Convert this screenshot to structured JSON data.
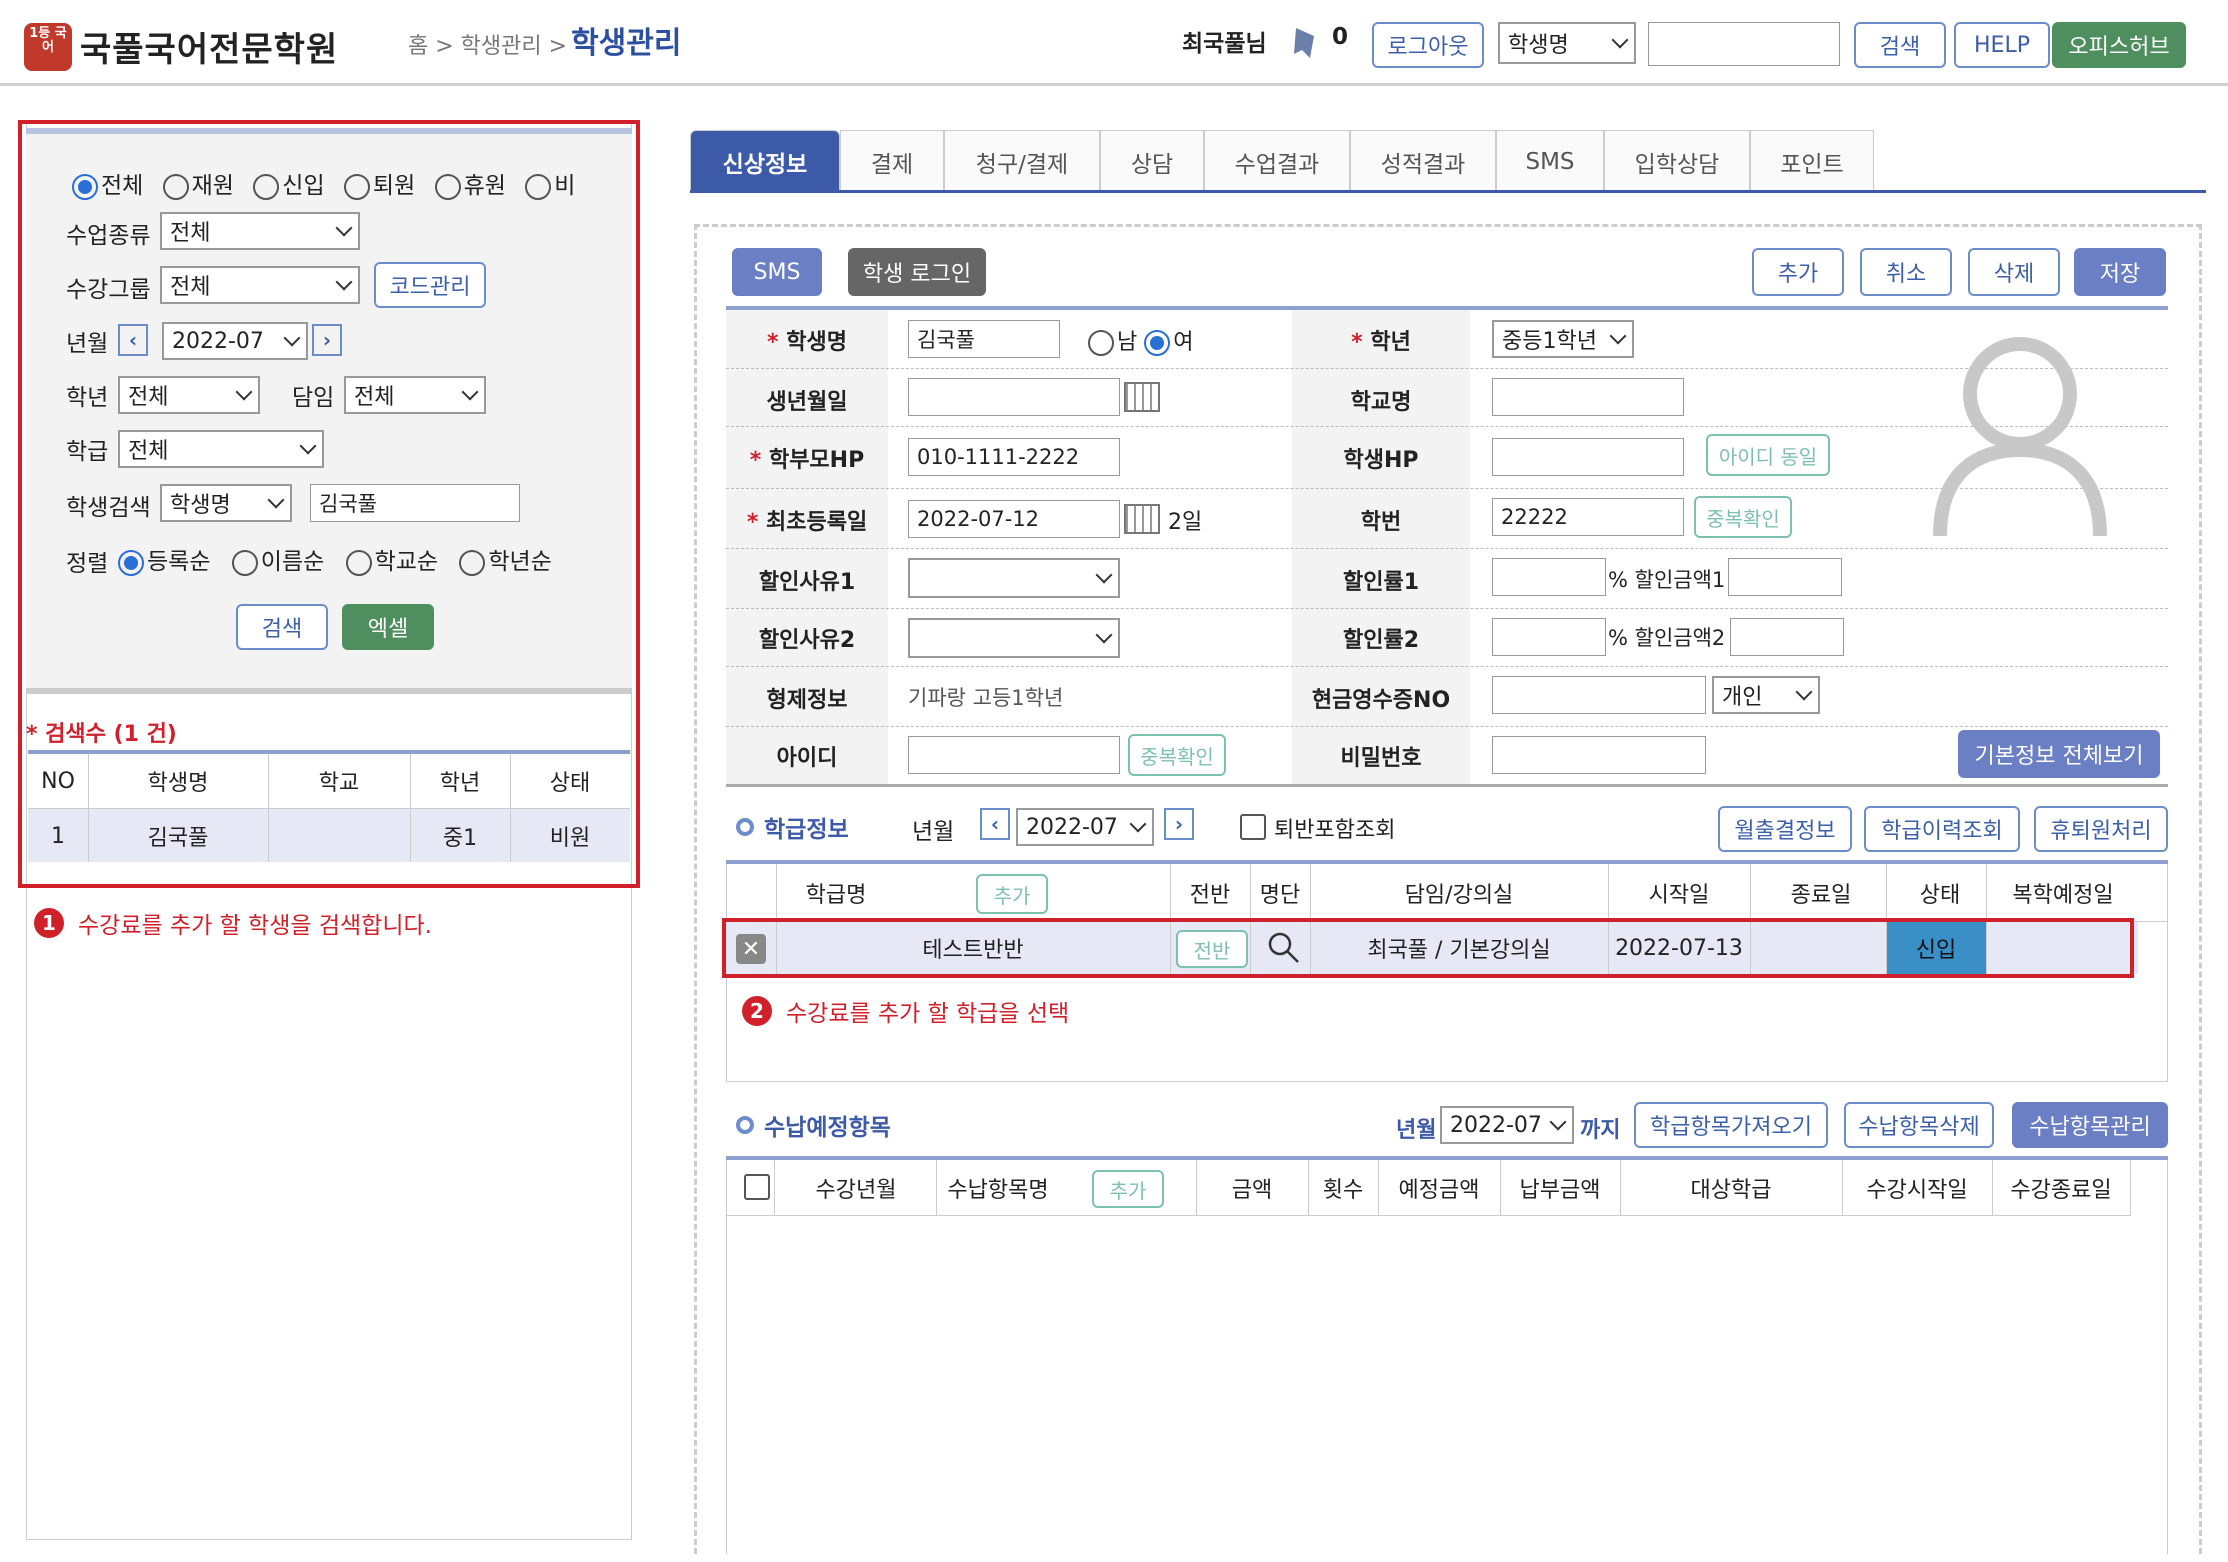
{
  "header": {
    "logo_mark": "1등 국어",
    "logo_name": "국풀국어전문학원",
    "breadcrumb": "홈 > 학생관리 >",
    "page_title": "학생관리",
    "user": "최국풀님",
    "notif_count": "0",
    "logout": "로그아웃",
    "search_type": "학생명",
    "search_value": "",
    "search_btn": "검색",
    "help": "HELP",
    "office": "오피스허브"
  },
  "filter": {
    "status_options": [
      "전체",
      "재원",
      "신입",
      "퇴원",
      "휴원",
      "비"
    ],
    "status_selected": "전체",
    "class_type_label": "수업종류",
    "class_type": "전체",
    "group_label": "수강그룹",
    "group": "전체",
    "code_btn": "코드관리",
    "ym_label": "년월",
    "ym": "2022-07",
    "grade_label": "학년",
    "grade": "전체",
    "teacher_label": "담임",
    "teacher": "전체",
    "class_label": "학급",
    "class": "전체",
    "student_search_label": "학생검색",
    "student_search_type": "학생명",
    "student_search_value": "김국풀",
    "sort_label": "정렬",
    "sort_options": [
      "등록순",
      "이름순",
      "학교순",
      "학년순"
    ],
    "sort_selected": "등록순",
    "search_btn": "검색",
    "excel_btn": "엑셀"
  },
  "results": {
    "count_text": "* 검색수 (1 건)",
    "columns": [
      "NO",
      "학생명",
      "학교",
      "학년",
      "상태"
    ],
    "rows": [
      [
        "1",
        "김국풀",
        "",
        "중1",
        "비원"
      ]
    ]
  },
  "note1": "수강료를 추가 할 학생을 검색합니다.",
  "note1_num": "1",
  "tabs": [
    "신상정보",
    "결제",
    "청구/결제",
    "상담",
    "수업결과",
    "성적결과",
    "SMS",
    "입학상담",
    "포인트"
  ],
  "active_tab": "신상정보",
  "toolbar": {
    "sms": "SMS",
    "student_login": "학생 로그인",
    "add": "추가",
    "cancel": "취소",
    "delete": "삭제",
    "save": "저장"
  },
  "profile": {
    "name_label": "학생명",
    "name": "김국풀",
    "gender_male": "남",
    "gender_female": "여",
    "gender_selected": "여",
    "grade_label": "학년",
    "grade": "중등1학년",
    "birth_label": "생년월일",
    "birth": "",
    "school_label": "학교명",
    "school": "",
    "parent_hp_label": "학부모HP",
    "parent_hp": "010-1111-2222",
    "student_hp_label": "학생HP",
    "student_hp": "",
    "same_id_btn": "아이디 동일",
    "first_reg_label": "최초등록일",
    "first_reg": "2022-07-12",
    "days": "2일",
    "student_no_label": "학번",
    "student_no": "22222",
    "dup_check": "중복확인",
    "discount_reason1_label": "할인사유1",
    "discount_rate1_label": "할인률1",
    "discount_amount1_label": "% 할인금액1",
    "discount_reason2_label": "할인사유2",
    "discount_rate2_label": "할인률2",
    "discount_amount2_label": "% 할인금액2",
    "sibling_label": "형제정보",
    "sibling": "기파랑 고등1학년",
    "receipt_label": "현금영수증NO",
    "receipt_type": "개인",
    "id_label": "아이디",
    "id_dup_check": "중복확인",
    "password_label": "비밀번호",
    "basic_info_btn": "기본정보 전체보기"
  },
  "class_info": {
    "title": "학급정보",
    "ym_label": "년월",
    "ym": "2022-07",
    "include_label": "퇴반포함조회",
    "monthly_btn": "월출결정보",
    "history_btn": "학급이력조회",
    "withdraw_btn": "휴퇴원처리",
    "columns": [
      "학급명",
      "전반",
      "명단",
      "담임/강의실",
      "시작일",
      "종료일",
      "상태",
      "복학예정일"
    ],
    "add_btn": "추가",
    "row": {
      "name": "테스트반반",
      "transfer": "전반",
      "teacher_room": "최국풀 / 기본강의실",
      "start": "2022-07-13",
      "end": "",
      "status": "신입",
      "return_date": ""
    }
  },
  "note2": "수강료를 추가 할 학급을 선택",
  "note2_num": "2",
  "payment": {
    "title": "수납예정항목",
    "ym_label": "년월",
    "ym": "2022-07",
    "until": "까지",
    "fetch_btn": "학급항목가져오기",
    "delete_btn": "수납항목삭제",
    "manage_btn": "수납항목관리",
    "columns": [
      "수강년월",
      "수납항목명",
      "금액",
      "횟수",
      "예정금액",
      "납부금액",
      "대상학급",
      "수강시작일",
      "수강종료일"
    ],
    "add_btn": "추가"
  },
  "colors": {
    "accent": "#3d5aa8",
    "highlight": "#d0202a",
    "green": "#4f8e5e",
    "status_blue": "#3a8fc6"
  }
}
